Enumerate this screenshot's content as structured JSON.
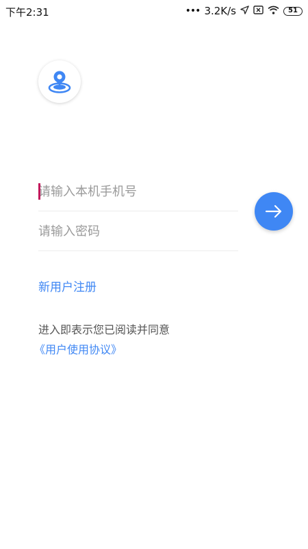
{
  "status_bar": {
    "time": "下午2:31",
    "network_speed": "3.2K/s",
    "battery_level": "51",
    "icons": [
      "signal-dots-icon",
      "location-arrow-icon",
      "sim-off-icon",
      "wifi-icon",
      "battery-icon"
    ]
  },
  "login": {
    "phone_placeholder": "请输入本机手机号",
    "password_placeholder": "请输入密码",
    "submit_icon": "arrow-right-icon",
    "register_label": "新用户注册",
    "agreement_text": "进入即表示您已阅读并同意",
    "agreement_link": "《用户使用协议》"
  },
  "colors": {
    "accent": "#3f87f4",
    "caret": "#c2185b",
    "text_primary": "#555555",
    "placeholder": "#9a9a9a"
  }
}
